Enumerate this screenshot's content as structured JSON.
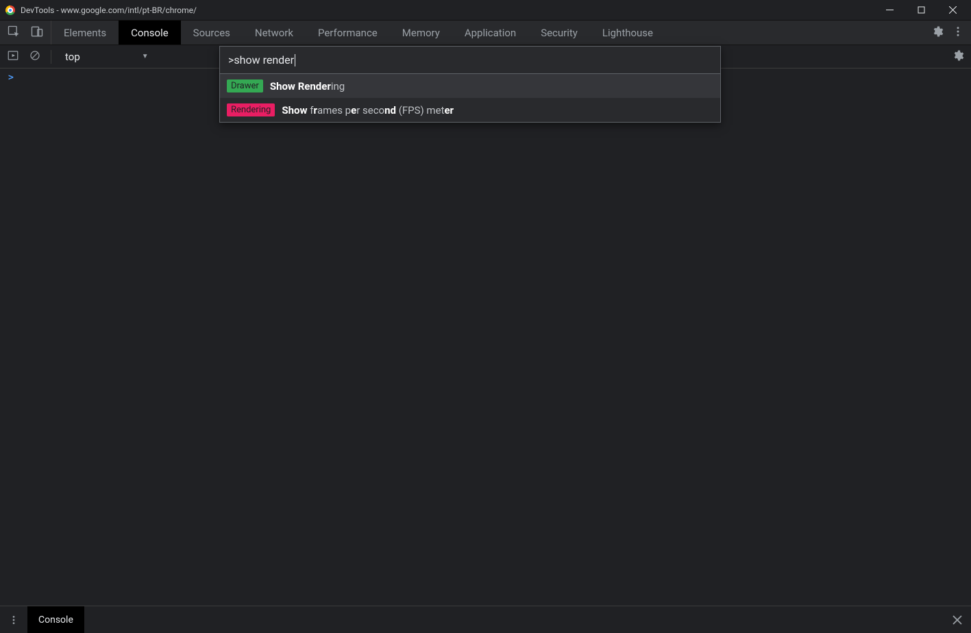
{
  "window": {
    "title": "DevTools - www.google.com/intl/pt-BR/chrome/"
  },
  "tabs": {
    "items": [
      {
        "label": "Elements",
        "active": false
      },
      {
        "label": "Console",
        "active": true
      },
      {
        "label": "Sources",
        "active": false
      },
      {
        "label": "Network",
        "active": false
      },
      {
        "label": "Performance",
        "active": false
      },
      {
        "label": "Memory",
        "active": false
      },
      {
        "label": "Application",
        "active": false
      },
      {
        "label": "Security",
        "active": false
      },
      {
        "label": "Lighthouse",
        "active": false
      }
    ]
  },
  "subtoolbar": {
    "context": "top"
  },
  "commandMenu": {
    "prefix": ">",
    "query": "show render",
    "results": [
      {
        "badge": "Drawer",
        "badgeClass": "badge-drawer",
        "html": "<b>Show</b> <b>Render</b><span>ing</span>",
        "selected": true
      },
      {
        "badge": "Rendering",
        "badgeClass": "badge-rendering",
        "html": "<b>Show</b> <span>f</span><b>r</b><span>ames p</span><b>e</b><span>r seco</span><b>nd</b><span> (FPS) met</span><b>er</b>",
        "selected": false
      }
    ]
  },
  "console": {
    "prompt": ">"
  },
  "drawer": {
    "tab": "Console"
  }
}
